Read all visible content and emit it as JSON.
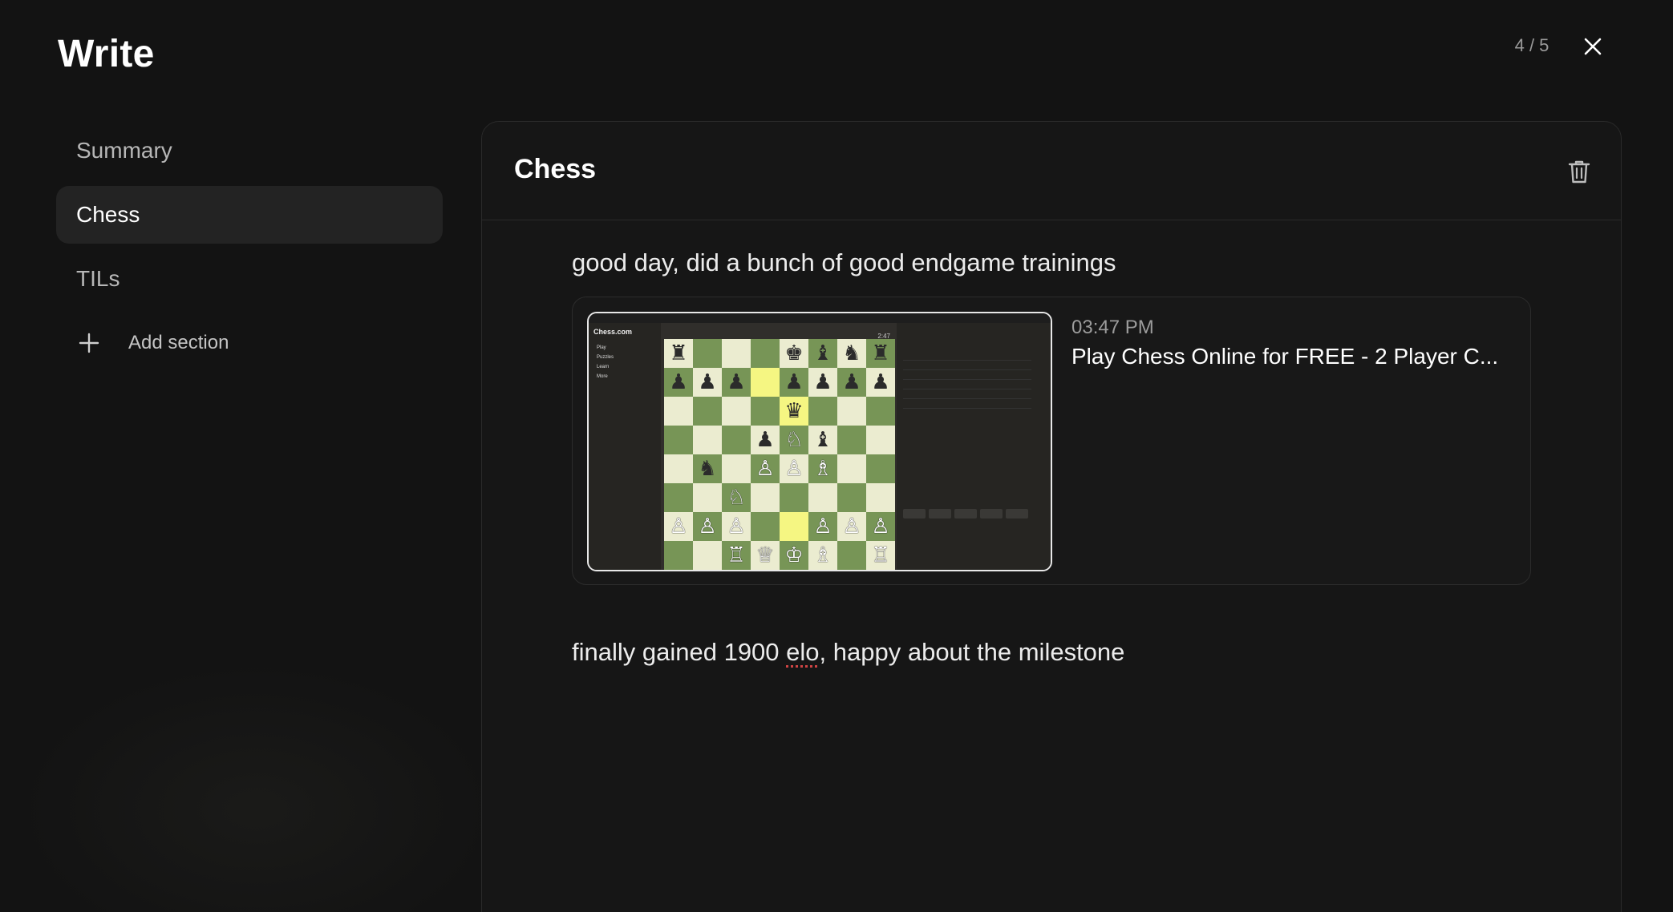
{
  "app": {
    "title": "Write",
    "pager": "4 / 5"
  },
  "sidebar": {
    "items": [
      {
        "label": "Summary",
        "active": false
      },
      {
        "label": "Chess",
        "active": true
      },
      {
        "label": "TILs",
        "active": false
      }
    ],
    "add_section_label": "Add section"
  },
  "panel": {
    "title": "Chess",
    "entries": {
      "first_text": "good day, did a bunch of good endgame trainings",
      "second_text_before": "finally gained 1900 ",
      "second_text_misspelled": "elo",
      "second_text_after": ", happy about the milestone"
    },
    "link_card": {
      "time": "03:47 PM",
      "title": "Play Chess Online for FREE - 2 Player C..."
    }
  },
  "thumbnail": {
    "logo": "Chess.com",
    "menu": [
      "Play",
      "Puzzles",
      "Learn",
      "More"
    ],
    "clock": "2:47",
    "board": [
      [
        "♜",
        "",
        "",
        "",
        "♚",
        "♝",
        "♞",
        "♜"
      ],
      [
        "♟",
        "♟",
        "♟",
        "",
        "♟",
        "♟",
        "♟",
        "♟"
      ],
      [
        "",
        "",
        "",
        "",
        "♛",
        "",
        "",
        ""
      ],
      [
        "",
        "",
        "",
        "♟",
        "♘",
        "♝",
        "",
        ""
      ],
      [
        "",
        "♞",
        "",
        "♙",
        "♙",
        "♗",
        "",
        ""
      ],
      [
        "",
        "",
        "♘",
        "",
        "",
        "",
        "",
        ""
      ],
      [
        "♙",
        "♙",
        "♙",
        "",
        "",
        "♙",
        "♙",
        "♙"
      ],
      [
        "",
        "",
        "♖",
        "♕",
        "♔",
        "♗",
        "",
        "♖"
      ]
    ],
    "highlight": [
      [
        1,
        3
      ],
      [
        6,
        4
      ],
      [
        2,
        4
      ]
    ],
    "colors": {
      "light": "#ebecd0",
      "dark": "#779556",
      "highlight": "#f5f682"
    }
  },
  "colors": {
    "background": "#131313",
    "panel": "#161616",
    "active_item": "#232323",
    "accent_text": "#ffffff",
    "muted_text": "#9a9a9a"
  }
}
